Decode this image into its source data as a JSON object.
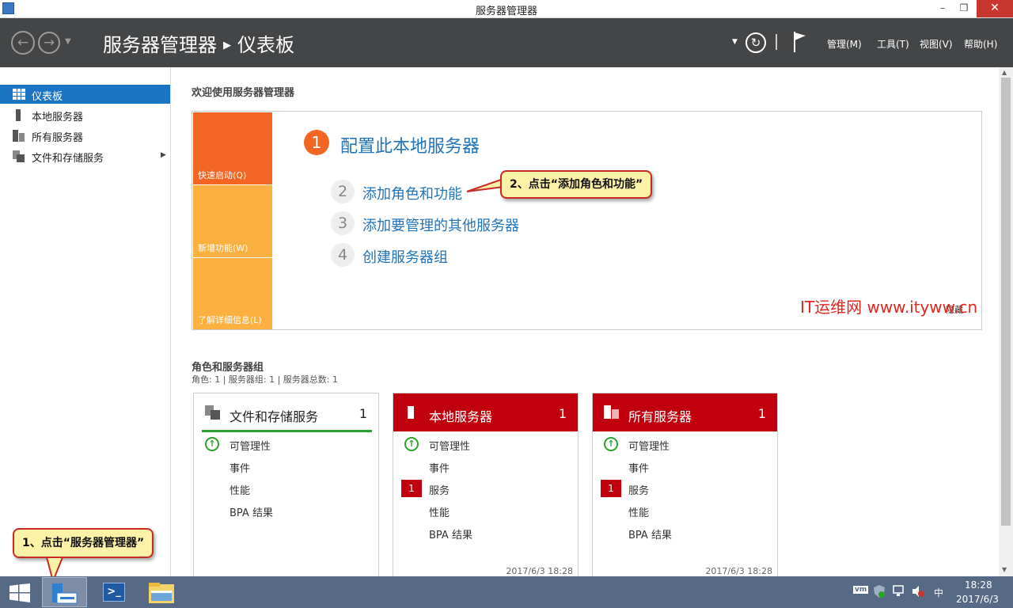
{
  "window": {
    "title": "服务器管理器",
    "min": "–",
    "restore": "❐",
    "close": "✕"
  },
  "header": {
    "breadcrumb_root": "服务器管理器",
    "breadcrumb_sep": "▶",
    "breadcrumb_current": "仪表板",
    "menus": [
      "管理(M)",
      "工具(T)",
      "视图(V)",
      "帮助(H)"
    ],
    "refresh_icon": "refresh-icon",
    "flag_icon": "flag-icon"
  },
  "sidebar": {
    "items": [
      {
        "label": "仪表板",
        "icon": "dashboard-icon"
      },
      {
        "label": "本地服务器",
        "icon": "server-icon"
      },
      {
        "label": "所有服务器",
        "icon": "servers-icon"
      },
      {
        "label": "文件和存储服务",
        "icon": "storage-icon",
        "arrow": "▶"
      }
    ]
  },
  "welcome": {
    "title": "欢迎使用服务器管理器",
    "tiles": [
      "快速启动(Q)",
      "新增功能(W)",
      "了解详细信息(L)"
    ],
    "steps": [
      {
        "num": "1",
        "label": "配置此本地服务器"
      },
      {
        "num": "2",
        "label": "添加角色和功能"
      },
      {
        "num": "3",
        "label": "添加要管理的其他服务器"
      },
      {
        "num": "4",
        "label": "创建服务器组"
      }
    ],
    "hide": "隐藏"
  },
  "roles": {
    "title": "角色和服务器组",
    "summary": "角色: 1 | 服务器组: 1 | 服务器总数: 1",
    "cards": [
      {
        "name": "文件和存储服务",
        "count": "1",
        "rows": [
          "可管理性",
          "事件",
          "性能",
          "BPA 结果"
        ],
        "timestamp": ""
      },
      {
        "name": "本地服务器",
        "count": "1",
        "rows": [
          "可管理性",
          "事件",
          "服务",
          "性能",
          "BPA 结果"
        ],
        "service_badge": "1",
        "timestamp": "2017/6/3 18:28"
      },
      {
        "name": "所有服务器",
        "count": "1",
        "rows": [
          "可管理性",
          "事件",
          "服务",
          "性能",
          "BPA 结果"
        ],
        "service_badge": "1",
        "timestamp": "2017/6/3 18:28"
      }
    ]
  },
  "callouts": {
    "step1": "1、点击“服务器管理器”",
    "step2": "2、点击“添加角色和功能”"
  },
  "watermark": "IT运维网 www.ityww.cn",
  "taskbar": {
    "time": "18:28",
    "date": "2017/6/3",
    "ime": "中",
    "tray_icons": [
      "vm-icon",
      "security-icon",
      "network-icon",
      "volume-muted-icon"
    ]
  },
  "colors": {
    "header_bg": "#434547",
    "accent_blue": "#1b73c4",
    "quickstart_orange": "#f26522",
    "tile_light_orange": "#fbb040",
    "alert_red": "#c0000d",
    "taskbar_bg": "#566a86"
  }
}
